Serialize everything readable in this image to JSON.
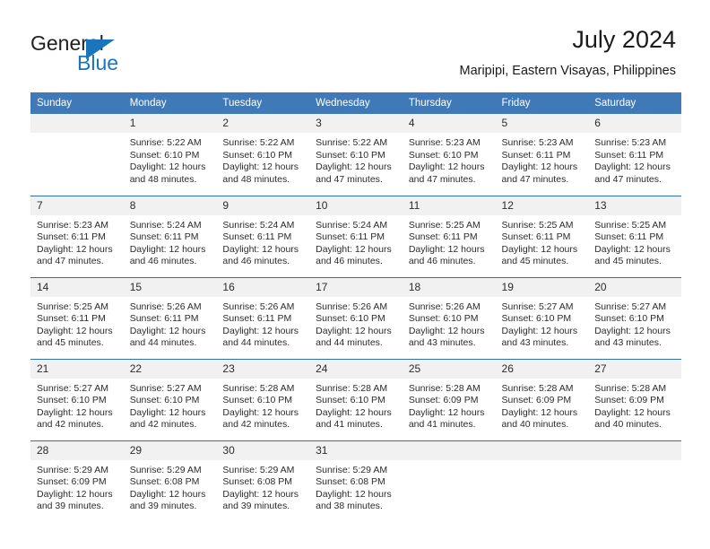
{
  "brand": {
    "name_part1": "General",
    "name_part2": "Blue"
  },
  "header": {
    "title": "July 2024",
    "location": "Maripipi, Eastern Visayas, Philippines"
  },
  "calendar": {
    "weekday_headers": [
      "Sunday",
      "Monday",
      "Tuesday",
      "Wednesday",
      "Thursday",
      "Friday",
      "Saturday"
    ],
    "accent_color": "#3f79b7",
    "daynum_band_color": "#f1f1f1",
    "weeks": [
      [
        {
          "day": "",
          "lines": []
        },
        {
          "day": "1",
          "lines": [
            "Sunrise: 5:22 AM",
            "Sunset: 6:10 PM",
            "Daylight: 12 hours",
            "and 48 minutes."
          ]
        },
        {
          "day": "2",
          "lines": [
            "Sunrise: 5:22 AM",
            "Sunset: 6:10 PM",
            "Daylight: 12 hours",
            "and 48 minutes."
          ]
        },
        {
          "day": "3",
          "lines": [
            "Sunrise: 5:22 AM",
            "Sunset: 6:10 PM",
            "Daylight: 12 hours",
            "and 47 minutes."
          ]
        },
        {
          "day": "4",
          "lines": [
            "Sunrise: 5:23 AM",
            "Sunset: 6:10 PM",
            "Daylight: 12 hours",
            "and 47 minutes."
          ]
        },
        {
          "day": "5",
          "lines": [
            "Sunrise: 5:23 AM",
            "Sunset: 6:11 PM",
            "Daylight: 12 hours",
            "and 47 minutes."
          ]
        },
        {
          "day": "6",
          "lines": [
            "Sunrise: 5:23 AM",
            "Sunset: 6:11 PM",
            "Daylight: 12 hours",
            "and 47 minutes."
          ]
        }
      ],
      [
        {
          "day": "7",
          "lines": [
            "Sunrise: 5:23 AM",
            "Sunset: 6:11 PM",
            "Daylight: 12 hours",
            "and 47 minutes."
          ]
        },
        {
          "day": "8",
          "lines": [
            "Sunrise: 5:24 AM",
            "Sunset: 6:11 PM",
            "Daylight: 12 hours",
            "and 46 minutes."
          ]
        },
        {
          "day": "9",
          "lines": [
            "Sunrise: 5:24 AM",
            "Sunset: 6:11 PM",
            "Daylight: 12 hours",
            "and 46 minutes."
          ]
        },
        {
          "day": "10",
          "lines": [
            "Sunrise: 5:24 AM",
            "Sunset: 6:11 PM",
            "Daylight: 12 hours",
            "and 46 minutes."
          ]
        },
        {
          "day": "11",
          "lines": [
            "Sunrise: 5:25 AM",
            "Sunset: 6:11 PM",
            "Daylight: 12 hours",
            "and 46 minutes."
          ]
        },
        {
          "day": "12",
          "lines": [
            "Sunrise: 5:25 AM",
            "Sunset: 6:11 PM",
            "Daylight: 12 hours",
            "and 45 minutes."
          ]
        },
        {
          "day": "13",
          "lines": [
            "Sunrise: 5:25 AM",
            "Sunset: 6:11 PM",
            "Daylight: 12 hours",
            "and 45 minutes."
          ]
        }
      ],
      [
        {
          "day": "14",
          "lines": [
            "Sunrise: 5:25 AM",
            "Sunset: 6:11 PM",
            "Daylight: 12 hours",
            "and 45 minutes."
          ]
        },
        {
          "day": "15",
          "lines": [
            "Sunrise: 5:26 AM",
            "Sunset: 6:11 PM",
            "Daylight: 12 hours",
            "and 44 minutes."
          ]
        },
        {
          "day": "16",
          "lines": [
            "Sunrise: 5:26 AM",
            "Sunset: 6:11 PM",
            "Daylight: 12 hours",
            "and 44 minutes."
          ]
        },
        {
          "day": "17",
          "lines": [
            "Sunrise: 5:26 AM",
            "Sunset: 6:10 PM",
            "Daylight: 12 hours",
            "and 44 minutes."
          ]
        },
        {
          "day": "18",
          "lines": [
            "Sunrise: 5:26 AM",
            "Sunset: 6:10 PM",
            "Daylight: 12 hours",
            "and 43 minutes."
          ]
        },
        {
          "day": "19",
          "lines": [
            "Sunrise: 5:27 AM",
            "Sunset: 6:10 PM",
            "Daylight: 12 hours",
            "and 43 minutes."
          ]
        },
        {
          "day": "20",
          "lines": [
            "Sunrise: 5:27 AM",
            "Sunset: 6:10 PM",
            "Daylight: 12 hours",
            "and 43 minutes."
          ]
        }
      ],
      [
        {
          "day": "21",
          "lines": [
            "Sunrise: 5:27 AM",
            "Sunset: 6:10 PM",
            "Daylight: 12 hours",
            "and 42 minutes."
          ]
        },
        {
          "day": "22",
          "lines": [
            "Sunrise: 5:27 AM",
            "Sunset: 6:10 PM",
            "Daylight: 12 hours",
            "and 42 minutes."
          ]
        },
        {
          "day": "23",
          "lines": [
            "Sunrise: 5:28 AM",
            "Sunset: 6:10 PM",
            "Daylight: 12 hours",
            "and 42 minutes."
          ]
        },
        {
          "day": "24",
          "lines": [
            "Sunrise: 5:28 AM",
            "Sunset: 6:10 PM",
            "Daylight: 12 hours",
            "and 41 minutes."
          ]
        },
        {
          "day": "25",
          "lines": [
            "Sunrise: 5:28 AM",
            "Sunset: 6:09 PM",
            "Daylight: 12 hours",
            "and 41 minutes."
          ]
        },
        {
          "day": "26",
          "lines": [
            "Sunrise: 5:28 AM",
            "Sunset: 6:09 PM",
            "Daylight: 12 hours",
            "and 40 minutes."
          ]
        },
        {
          "day": "27",
          "lines": [
            "Sunrise: 5:28 AM",
            "Sunset: 6:09 PM",
            "Daylight: 12 hours",
            "and 40 minutes."
          ]
        }
      ],
      [
        {
          "day": "28",
          "lines": [
            "Sunrise: 5:29 AM",
            "Sunset: 6:09 PM",
            "Daylight: 12 hours",
            "and 39 minutes."
          ]
        },
        {
          "day": "29",
          "lines": [
            "Sunrise: 5:29 AM",
            "Sunset: 6:08 PM",
            "Daylight: 12 hours",
            "and 39 minutes."
          ]
        },
        {
          "day": "30",
          "lines": [
            "Sunrise: 5:29 AM",
            "Sunset: 6:08 PM",
            "Daylight: 12 hours",
            "and 39 minutes."
          ]
        },
        {
          "day": "31",
          "lines": [
            "Sunrise: 5:29 AM",
            "Sunset: 6:08 PM",
            "Daylight: 12 hours",
            "and 38 minutes."
          ]
        },
        {
          "day": "",
          "lines": []
        },
        {
          "day": "",
          "lines": []
        },
        {
          "day": "",
          "lines": []
        }
      ]
    ]
  }
}
